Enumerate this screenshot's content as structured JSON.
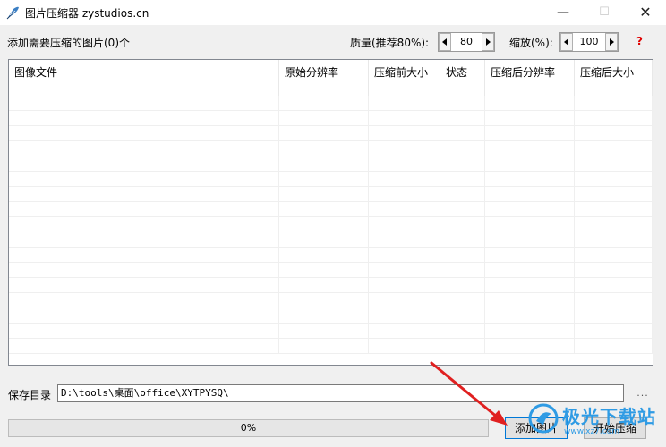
{
  "window": {
    "title": "图片压缩器 zystudios.cn",
    "minimize": "—",
    "maximize": "☐",
    "close": "✕"
  },
  "toolbar": {
    "add_count_label": "添加需要压缩的图片(0)个",
    "quality_label": "质量(推荐80%):",
    "quality_value": "80",
    "scale_label": "缩放(%):",
    "scale_value": "100",
    "help_label": "?"
  },
  "table": {
    "columns": [
      "图像文件",
      "原始分辨率",
      "压缩前大小",
      "状态",
      "压缩后分辨率",
      "压缩后大小"
    ],
    "rows": []
  },
  "save": {
    "label": "保存目录",
    "path": "D:\\tools\\桌面\\office\\XYTPYSQ\\",
    "browse": "..."
  },
  "progress": {
    "text": "0%",
    "value": 0
  },
  "buttons": {
    "add_images": "添加图片",
    "start_compress": "开始压缩"
  },
  "watermark": {
    "cn": "极光下载站",
    "en": "www.xz7.com"
  },
  "colors": {
    "help": "#e00000",
    "arrow": "#e02020",
    "watermark": "#2f9be4",
    "progress_fill": "#06b025"
  }
}
